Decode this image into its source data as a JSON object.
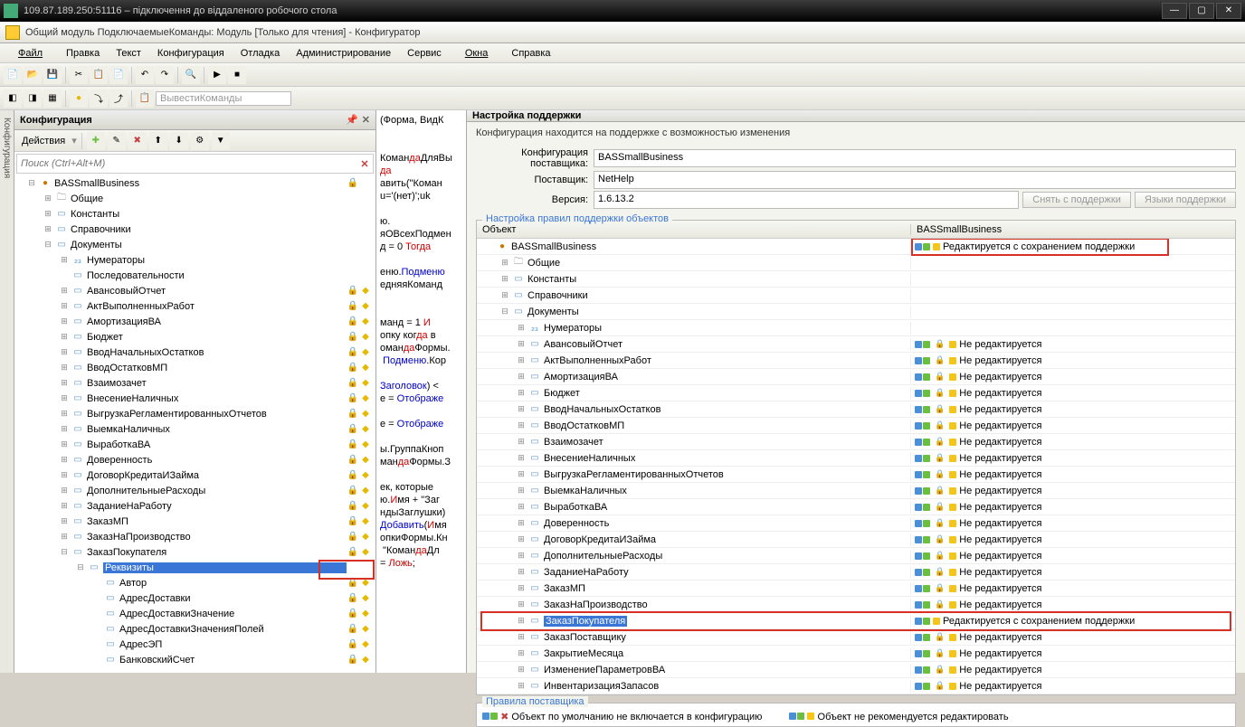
{
  "window": {
    "title": "109.87.189.250:51116 – підключення до віддаленого робочого стола"
  },
  "app": {
    "title": "Общий модуль ПодключаемыеКоманды: Модуль [Только для чтения] - Конфигуратор"
  },
  "menu": {
    "file": "Файл",
    "edit": "Правка",
    "text": "Текст",
    "config": "Конфигурация",
    "debug": "Отладка",
    "admin": "Администрирование",
    "service": "Сервис",
    "windows": "Окна",
    "help": "Справка"
  },
  "toolbar2": {
    "btn": "ВывестиКоманды"
  },
  "leftPanel": {
    "title": "Конфигурация",
    "actions": "Действия",
    "searchPlaceholder": "Поиск (Ctrl+Alt+M)"
  },
  "tree": [
    {
      "l": 0,
      "exp": "-",
      "icon": "pk",
      "label": "BASSmallBusiness",
      "lock": true,
      "cube": false
    },
    {
      "l": 1,
      "exp": "+",
      "icon": "folder",
      "label": "Общие"
    },
    {
      "l": 1,
      "exp": "+",
      "icon": "doc",
      "label": "Константы"
    },
    {
      "l": 1,
      "exp": "+",
      "icon": "doc",
      "label": "Справочники"
    },
    {
      "l": 1,
      "exp": "-",
      "icon": "doc",
      "label": "Документы"
    },
    {
      "l": 2,
      "exp": "+",
      "icon": "num",
      "label": "Нумераторы"
    },
    {
      "l": 2,
      "exp": "",
      "icon": "doc",
      "label": "Последовательности"
    },
    {
      "l": 2,
      "exp": "+",
      "icon": "doc",
      "label": "АвансовыйОтчет",
      "lock": true,
      "cube": true
    },
    {
      "l": 2,
      "exp": "+",
      "icon": "doc",
      "label": "АктВыполненныхРабот",
      "lock": true,
      "cube": true
    },
    {
      "l": 2,
      "exp": "+",
      "icon": "doc",
      "label": "АмортизацияВА",
      "lock": true,
      "cube": true
    },
    {
      "l": 2,
      "exp": "+",
      "icon": "doc",
      "label": "Бюджет",
      "lock": true,
      "cube": true
    },
    {
      "l": 2,
      "exp": "+",
      "icon": "doc",
      "label": "ВводНачальныхОстатков",
      "lock": true,
      "cube": true
    },
    {
      "l": 2,
      "exp": "+",
      "icon": "doc",
      "label": "ВводОстатковМП",
      "lock": true,
      "cube": true
    },
    {
      "l": 2,
      "exp": "+",
      "icon": "doc",
      "label": "Взаимозачет",
      "lock": true,
      "cube": true
    },
    {
      "l": 2,
      "exp": "+",
      "icon": "doc",
      "label": "ВнесениеНаличных",
      "lock": true,
      "cube": true
    },
    {
      "l": 2,
      "exp": "+",
      "icon": "doc",
      "label": "ВыгрузкаРегламентированныхОтчетов",
      "lock": true,
      "cube": true
    },
    {
      "l": 2,
      "exp": "+",
      "icon": "doc",
      "label": "ВыемкаНаличных",
      "lock": true,
      "cube": true
    },
    {
      "l": 2,
      "exp": "+",
      "icon": "doc",
      "label": "ВыработкаВА",
      "lock": true,
      "cube": true
    },
    {
      "l": 2,
      "exp": "+",
      "icon": "doc",
      "label": "Доверенность",
      "lock": true,
      "cube": true
    },
    {
      "l": 2,
      "exp": "+",
      "icon": "doc",
      "label": "ДоговорКредитаИЗайма",
      "lock": true,
      "cube": true
    },
    {
      "l": 2,
      "exp": "+",
      "icon": "doc",
      "label": "ДополнительныеРасходы",
      "lock": true,
      "cube": true
    },
    {
      "l": 2,
      "exp": "+",
      "icon": "doc",
      "label": "ЗаданиеНаРаботу",
      "lock": true,
      "cube": true
    },
    {
      "l": 2,
      "exp": "+",
      "icon": "doc",
      "label": "ЗаказМП",
      "lock": true,
      "cube": true
    },
    {
      "l": 2,
      "exp": "+",
      "icon": "doc",
      "label": "ЗаказНаПроизводство",
      "lock": true,
      "cube": true
    },
    {
      "l": 2,
      "exp": "-",
      "icon": "doc",
      "label": "ЗаказПокупателя",
      "lock": true,
      "cube": true,
      "hl": true
    },
    {
      "l": 3,
      "exp": "-",
      "icon": "doc",
      "label": "Реквизиты",
      "sel": true
    },
    {
      "l": 4,
      "exp": "",
      "icon": "doc",
      "label": "Автор",
      "lock": true,
      "cube": true
    },
    {
      "l": 4,
      "exp": "",
      "icon": "doc",
      "label": "АдресДоставки",
      "lock": true,
      "cube": true
    },
    {
      "l": 4,
      "exp": "",
      "icon": "doc",
      "label": "АдресДоставкиЗначение",
      "lock": true,
      "cube": true
    },
    {
      "l": 4,
      "exp": "",
      "icon": "doc",
      "label": "АдресДоставкиЗначенияПолей",
      "lock": true,
      "cube": true
    },
    {
      "l": 4,
      "exp": "",
      "icon": "doc",
      "label": "АдресЭП",
      "lock": true,
      "cube": true
    },
    {
      "l": 4,
      "exp": "",
      "icon": "doc",
      "label": "БанковскийСчет",
      "lock": true,
      "cube": true
    }
  ],
  "code": [
    [
      "(Форма, ВидК",
      ""
    ],
    [
      "",
      ""
    ],
    [
      "",
      ""
    ],
    [
      "КомандаДляВы",
      ""
    ],
    [
      "да",
      ""
    ],
    [
      "авить(\"Коман",
      ""
    ],
    [
      "u='(нет)';uk",
      ""
    ],
    [
      "",
      ""
    ],
    [
      "ю.",
      ""
    ],
    [
      "яОВсехПодмен",
      ""
    ],
    [
      "д = 0 Тогда",
      ""
    ],
    [
      "",
      ""
    ],
    [
      "еню.Подменю",
      ""
    ],
    [
      "едняяКоманд",
      ""
    ],
    [
      "",
      ""
    ],
    [
      "",
      ""
    ],
    [
      "манд = 1 И",
      ""
    ],
    [
      "опку когда в",
      ""
    ],
    [
      "омандаФормы.",
      ""
    ],
    [
      " Подменю.Кор",
      ""
    ],
    [
      "",
      ""
    ],
    [
      "Заголовок) <",
      ""
    ],
    [
      "е = Отображе",
      ""
    ],
    [
      "",
      ""
    ],
    [
      "е = Отображе",
      ""
    ],
    [
      "",
      ""
    ],
    [
      "ы.ГруппаКноп",
      ""
    ],
    [
      "мандаФормы.З",
      ""
    ],
    [
      "",
      ""
    ],
    [
      "ек, которые",
      ""
    ],
    [
      "ю.Имя + \"Заг",
      ""
    ],
    [
      "ндыЗаглушки)",
      ""
    ],
    [
      "Добавить(Имя",
      ""
    ],
    [
      "опкиФормы.Кн",
      ""
    ],
    [
      " \"КомандаДл",
      ""
    ],
    [
      "= Ложь;",
      ""
    ]
  ],
  "support": {
    "title": "Настройка поддержки",
    "info": "Конфигурация находится на поддержке с возможностью изменения",
    "supplierConfigLabel": "Конфигурация поставщика:",
    "supplierConfig": "BASSmallBusiness",
    "supplierLabel": "Поставщик:",
    "supplier": "NetHelp",
    "versionLabel": "Версия:",
    "version": "1.6.13.2",
    "btnRemove": "Снять с поддержки",
    "btnLang": "Языки поддержки",
    "groupTitle": "Настройка правил поддержки объектов",
    "col1": "Объект",
    "col2": "BASSmallBusiness",
    "statusEditSave": "Редактируется с сохранением поддержки",
    "statusNoEdit": "Не редактируется",
    "rulesTitle": "Правила поставщика",
    "rule1": "Объект по умолчанию не включается в конфигурацию",
    "rule2": "Объект не рекомендуется редактировать"
  },
  "objTree": [
    {
      "l": 0,
      "exp": "",
      "icon": "pk",
      "label": "BASSmallBusiness",
      "status": "edit",
      "hl": true
    },
    {
      "l": 1,
      "exp": "+",
      "icon": "folder",
      "label": "Общие",
      "status": ""
    },
    {
      "l": 1,
      "exp": "+",
      "icon": "doc",
      "label": "Константы",
      "status": ""
    },
    {
      "l": 1,
      "exp": "+",
      "icon": "doc",
      "label": "Справочники",
      "status": ""
    },
    {
      "l": 1,
      "exp": "-",
      "icon": "doc",
      "label": "Документы",
      "status": ""
    },
    {
      "l": 2,
      "exp": "+",
      "icon": "num",
      "label": "Нумераторы",
      "status": ""
    },
    {
      "l": 2,
      "exp": "+",
      "icon": "doc",
      "label": "АвансовыйОтчет",
      "status": "noedit"
    },
    {
      "l": 2,
      "exp": "+",
      "icon": "doc",
      "label": "АктВыполненныхРабот",
      "status": "noedit"
    },
    {
      "l": 2,
      "exp": "+",
      "icon": "doc",
      "label": "АмортизацияВА",
      "status": "noedit"
    },
    {
      "l": 2,
      "exp": "+",
      "icon": "doc",
      "label": "Бюджет",
      "status": "noedit"
    },
    {
      "l": 2,
      "exp": "+",
      "icon": "doc",
      "label": "ВводНачальныхОстатков",
      "status": "noedit"
    },
    {
      "l": 2,
      "exp": "+",
      "icon": "doc",
      "label": "ВводОстатковМП",
      "status": "noedit"
    },
    {
      "l": 2,
      "exp": "+",
      "icon": "doc",
      "label": "Взаимозачет",
      "status": "noedit"
    },
    {
      "l": 2,
      "exp": "+",
      "icon": "doc",
      "label": "ВнесениеНаличных",
      "status": "noedit"
    },
    {
      "l": 2,
      "exp": "+",
      "icon": "doc",
      "label": "ВыгрузкаРегламентированныхОтчетов",
      "status": "noedit"
    },
    {
      "l": 2,
      "exp": "+",
      "icon": "doc",
      "label": "ВыемкаНаличных",
      "status": "noedit"
    },
    {
      "l": 2,
      "exp": "+",
      "icon": "doc",
      "label": "ВыработкаВА",
      "status": "noedit"
    },
    {
      "l": 2,
      "exp": "+",
      "icon": "doc",
      "label": "Доверенность",
      "status": "noedit"
    },
    {
      "l": 2,
      "exp": "+",
      "icon": "doc",
      "label": "ДоговорКредитаИЗайма",
      "status": "noedit"
    },
    {
      "l": 2,
      "exp": "+",
      "icon": "doc",
      "label": "ДополнительныеРасходы",
      "status": "noedit"
    },
    {
      "l": 2,
      "exp": "+",
      "icon": "doc",
      "label": "ЗаданиеНаРаботу",
      "status": "noedit"
    },
    {
      "l": 2,
      "exp": "+",
      "icon": "doc",
      "label": "ЗаказМП",
      "status": "noedit"
    },
    {
      "l": 2,
      "exp": "+",
      "icon": "doc",
      "label": "ЗаказНаПроизводство",
      "status": "noedit"
    },
    {
      "l": 2,
      "exp": "+",
      "icon": "doc",
      "label": "ЗаказПокупателя",
      "status": "edit",
      "hl": true,
      "sel": true
    },
    {
      "l": 2,
      "exp": "+",
      "icon": "doc",
      "label": "ЗаказПоставщику",
      "status": "noedit"
    },
    {
      "l": 2,
      "exp": "+",
      "icon": "doc",
      "label": "ЗакрытиеМесяца",
      "status": "noedit"
    },
    {
      "l": 2,
      "exp": "+",
      "icon": "doc",
      "label": "ИзменениеПараметровВА",
      "status": "noedit"
    },
    {
      "l": 2,
      "exp": "+",
      "icon": "doc",
      "label": "ИнвентаризацияЗапасов",
      "status": "noedit"
    }
  ]
}
